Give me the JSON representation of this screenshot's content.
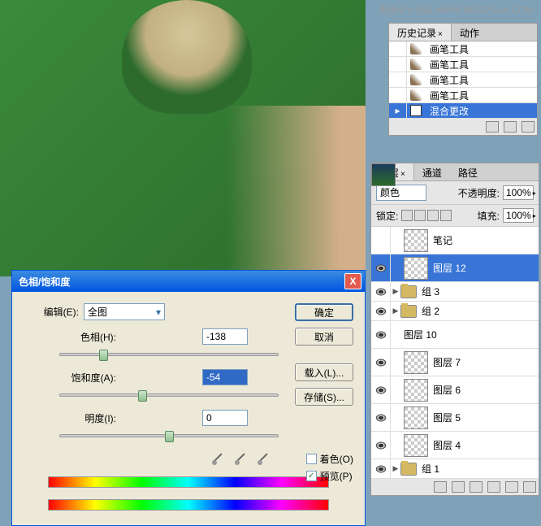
{
  "watermark": "思缘设计论坛  WWW.MISSYUAN.COM",
  "history": {
    "tabs": {
      "history": "历史记录",
      "actions": "动作"
    },
    "items": [
      {
        "label": "画笔工具",
        "icon": "brush",
        "selected": false
      },
      {
        "label": "画笔工具",
        "icon": "brush",
        "selected": false
      },
      {
        "label": "画笔工具",
        "icon": "brush",
        "selected": false
      },
      {
        "label": "画笔工具",
        "icon": "brush",
        "selected": false
      },
      {
        "label": "混合更改",
        "icon": "blend",
        "selected": true
      }
    ]
  },
  "layers": {
    "tabs": {
      "layers": "图层",
      "channels": "通道",
      "paths": "路径"
    },
    "blend_mode": "颜色",
    "opacity_label": "不透明度:",
    "opacity_value": "100%",
    "lock_label": "锁定:",
    "fill_label": "填充:",
    "fill_value": "100%",
    "items": [
      {
        "name": "笔记",
        "visible": false,
        "type": "layer",
        "thumb": "trans"
      },
      {
        "name": "图层 12",
        "visible": true,
        "type": "layer",
        "thumb": "trans",
        "selected": true
      },
      {
        "name": "组 3",
        "visible": true,
        "type": "group"
      },
      {
        "name": "组 2",
        "visible": true,
        "type": "group"
      },
      {
        "name": "图层 10",
        "visible": true,
        "type": "layer",
        "thumb": "photo"
      },
      {
        "name": "图层 7",
        "visible": true,
        "type": "layer",
        "thumb": "trans"
      },
      {
        "name": "图层 6",
        "visible": true,
        "type": "layer",
        "thumb": "trans"
      },
      {
        "name": "图层 5",
        "visible": true,
        "type": "layer",
        "thumb": "trans"
      },
      {
        "name": "图层 4",
        "visible": true,
        "type": "layer",
        "thumb": "trans"
      },
      {
        "name": "组 1",
        "visible": true,
        "type": "group"
      }
    ]
  },
  "dialog": {
    "title": "色相/饱和度",
    "edit_label": "编辑(E):",
    "edit_value": "全图",
    "hue_label": "色相(H):",
    "hue_value": "-138",
    "sat_label": "饱和度(A):",
    "sat_value": "-54",
    "light_label": "明度(I):",
    "light_value": "0",
    "buttons": {
      "ok": "确定",
      "cancel": "取消",
      "load": "载入(L)...",
      "save": "存储(S)..."
    },
    "checks": {
      "colorize": "着色(O)",
      "preview": "预览(P)"
    },
    "colorize_checked": false,
    "preview_checked": true
  }
}
